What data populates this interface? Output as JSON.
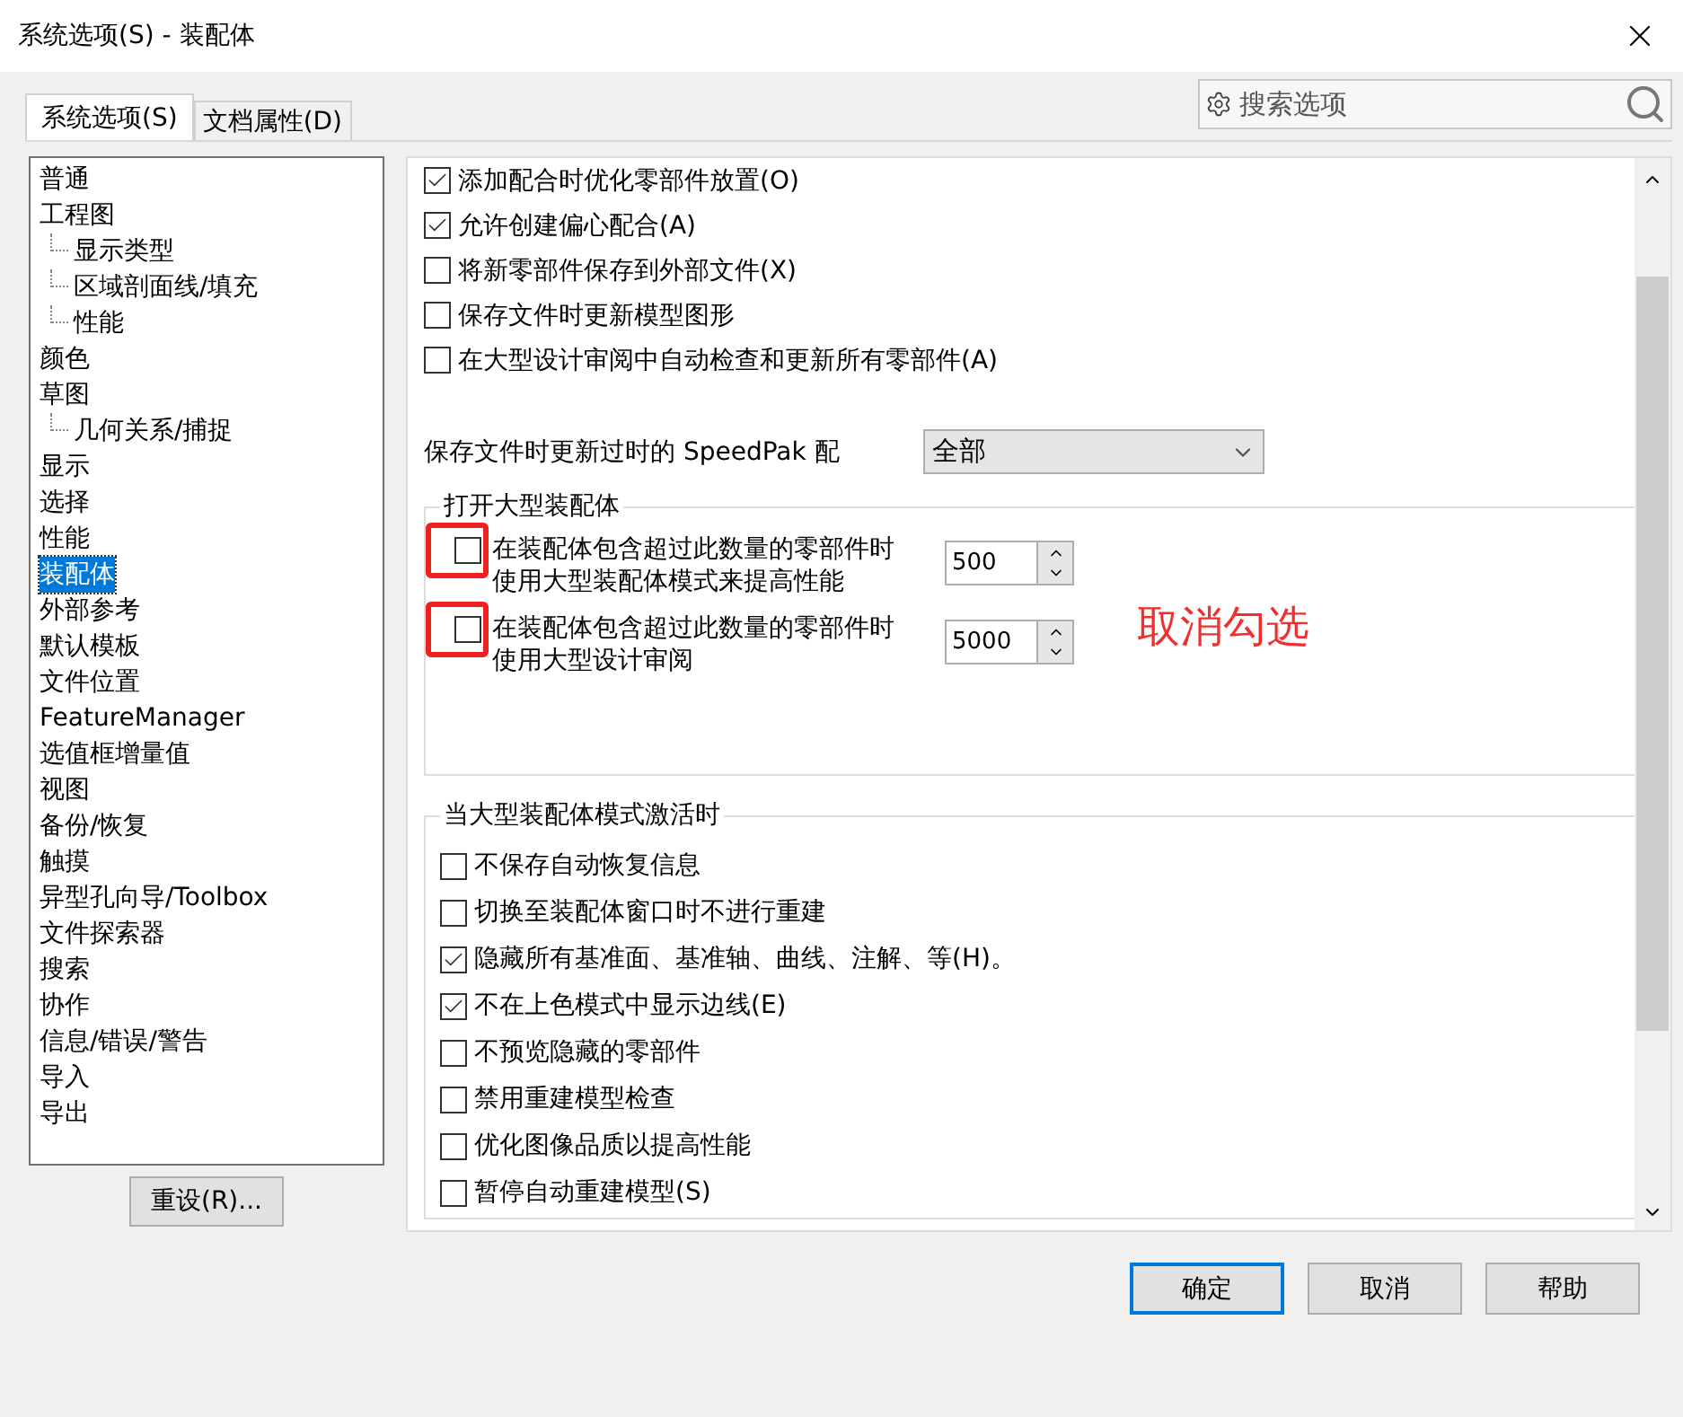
{
  "window": {
    "title": "系统选项(S) - 装配体"
  },
  "tabs": [
    {
      "label": "系统选项(S)",
      "selected": true
    },
    {
      "label": "文档属性(D)",
      "selected": false
    }
  ],
  "search": {
    "placeholder": "搜索选项"
  },
  "sidebar": {
    "items": [
      {
        "label": "普通",
        "selected": false
      },
      {
        "label": "工程图",
        "selected": false,
        "children": [
          {
            "label": "显示类型",
            "selected": false
          },
          {
            "label": "区域剖面线/填充",
            "selected": false
          },
          {
            "label": "性能",
            "selected": false
          }
        ]
      },
      {
        "label": "颜色",
        "selected": false
      },
      {
        "label": "草图",
        "selected": false,
        "children": [
          {
            "label": "几何关系/捕捉",
            "selected": false
          }
        ]
      },
      {
        "label": "显示",
        "selected": false
      },
      {
        "label": "选择",
        "selected": false
      },
      {
        "label": "性能",
        "selected": false
      },
      {
        "label": "装配体",
        "selected": true
      },
      {
        "label": "外部参考",
        "selected": false
      },
      {
        "label": "默认模板",
        "selected": false
      },
      {
        "label": "文件位置",
        "selected": false
      },
      {
        "label": "FeatureManager",
        "selected": false
      },
      {
        "label": "选值框增量值",
        "selected": false
      },
      {
        "label": "视图",
        "selected": false
      },
      {
        "label": "备份/恢复",
        "selected": false
      },
      {
        "label": "触摸",
        "selected": false
      },
      {
        "label": "异型孔向导/Toolbox",
        "selected": false
      },
      {
        "label": "文件探索器",
        "selected": false
      },
      {
        "label": "搜索",
        "selected": false
      },
      {
        "label": "协作",
        "selected": false
      },
      {
        "label": "信息/错误/警告",
        "selected": false
      },
      {
        "label": "导入",
        "selected": false
      },
      {
        "label": "导出",
        "selected": false
      }
    ]
  },
  "reset_button": "重设(R)...",
  "options": [
    {
      "label": "添加配合时优化零部件放置(O)",
      "checked": true
    },
    {
      "label": "允许创建偏心配合(A)",
      "checked": true
    },
    {
      "label": "将新零部件保存到外部文件(X)",
      "checked": false
    },
    {
      "label": "保存文件时更新模型图形",
      "checked": false
    },
    {
      "label": "在大型设计审阅中自动检查和更新所有零部件(A)",
      "checked": false
    }
  ],
  "speedpak": {
    "label": "保存文件时更新过时的 SpeedPak 配",
    "value": "全部"
  },
  "large_assembly_open": {
    "title": "打开大型装配体",
    "rows": [
      {
        "label": "在装配体包含超过此数量的零部件时",
        "sublabel": "使用大型装配体模式来提高性能",
        "checked": false,
        "value": "500",
        "highlighted": true
      },
      {
        "label": "在装配体包含超过此数量的零部件时",
        "sublabel": "使用大型设计审阅",
        "checked": false,
        "value": "5000",
        "highlighted": true
      }
    ]
  },
  "annotation": "取消勾选",
  "large_assembly_mode": {
    "title": "当大型装配体模式激活时",
    "options": [
      {
        "label": "不保存自动恢复信息",
        "checked": false
      },
      {
        "label": "切换至装配体窗口时不进行重建",
        "checked": false
      },
      {
        "label": "隐藏所有基准面、基准轴、曲线、注解、等(H)。",
        "checked": true
      },
      {
        "label": "不在上色模式中显示边线(E)",
        "checked": true
      },
      {
        "label": "不预览隐藏的零部件",
        "checked": false
      },
      {
        "label": "禁用重建模型检查",
        "checked": false
      },
      {
        "label": "优化图像品质以提高性能",
        "checked": false
      },
      {
        "label": "暂停自动重建模型(S)",
        "checked": false
      }
    ]
  },
  "buttons": [
    {
      "label": "确定",
      "default": true
    },
    {
      "label": "取消",
      "default": false
    },
    {
      "label": "帮助",
      "default": false
    }
  ]
}
